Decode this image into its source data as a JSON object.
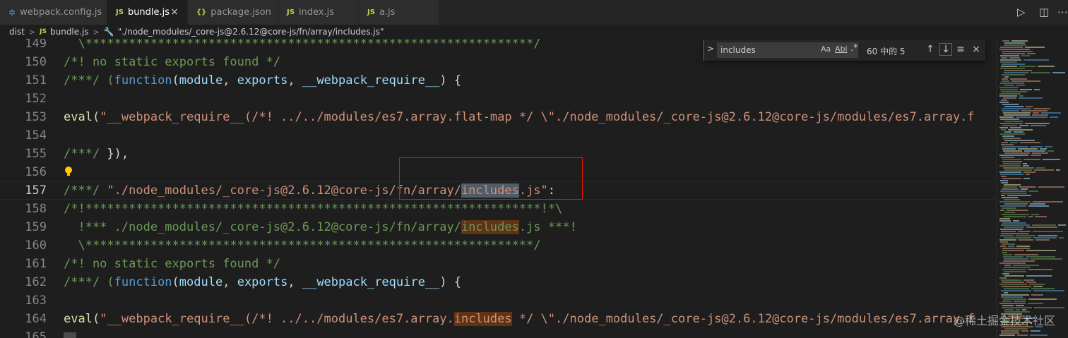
{
  "tabs": [
    {
      "label": "webpack.config.js",
      "icon": "webpack-icon",
      "active": false
    },
    {
      "label": "bundle.js",
      "icon": "js-file-icon",
      "active": true
    },
    {
      "label": "package.json",
      "icon": "json-file-icon",
      "active": false
    },
    {
      "label": "index.js",
      "icon": "js-file-icon",
      "active": false
    },
    {
      "label": "a.js",
      "icon": "js-file-icon",
      "active": false
    }
  ],
  "tab_icons": {
    "js": "JS",
    "json": "{}",
    "cfg": "✲",
    "close": "×",
    "run": "▷",
    "split": "◫",
    "more": "⋯"
  },
  "breadcrumb": {
    "folder": "dist",
    "file": "bundle.js",
    "symbol": "\"./node_modules/_core-js@2.6.12@core-js/fn/array/includes.js\""
  },
  "find": {
    "query": "includes",
    "match_case": "Aa",
    "whole_word": "Abl",
    "regex": ".*",
    "result_count": "60 中的 5"
  },
  "editor": {
    "line_numbers": [
      "149",
      "150",
      "151",
      "152",
      "153",
      "154",
      "155",
      "156",
      "157",
      "158",
      "159",
      "160",
      "161",
      "162",
      "163",
      "164",
      "165"
    ],
    "current_line": "157",
    "lines": {
      "l149": "  \\**************************************************************/",
      "l150": "/*! no static exports found */",
      "l151a": "/***/ (",
      "l151b": "function",
      "l151c": "(",
      "l151d": "module",
      "l151e": ", ",
      "l151f": "exports",
      "l151g": ", ",
      "l151h": "__webpack_require__",
      "l151i": ") {",
      "l153a": "eval",
      "l153b": "(",
      "l153c": "\"__webpack_require__(/*! ../../modules/es7.array.flat-map */ \\\"./node_modules/_core-js@2.6.12@core-js/modules/es7.array.f",
      "l155a": "/***/ ",
      "l155b": "}),",
      "l157a": "/***/ ",
      "l157b": "\"./node_modules/_core-js@2.6.12@core-js/fn/array/",
      "l157c": "includes",
      "l157d": ".js\"",
      "l157e": ":",
      "l158": "/*!***************************************************************!*\\",
      "l159a": "  !*** ./node_modules/_core-js@2.6.12@core-js/fn/array/",
      "l159b": "includes",
      "l159c": ".js ***!",
      "l160": "  \\**************************************************************/",
      "l161": "/*! no static exports found */",
      "l162a": "/***/ (",
      "l162b": "function",
      "l162c": "(",
      "l162d": "module",
      "l162e": ", ",
      "l162f": "exports",
      "l162g": ", ",
      "l162h": "__webpack_require__",
      "l162i": ") {",
      "l164a": "eval",
      "l164b": "(",
      "l164c": "\"__webpack_require__(/*! ../../modules/es7.array.",
      "l164d": "includes",
      "l164e": " */ \\\"./node_modules/_core-js@2.6.12@core-js/modules/es7.array.f"
    }
  },
  "watermark": "@稀土掘金技术社区",
  "colors": {
    "highlight_box": "#e51400",
    "current_match": "#515c6a",
    "other_match": "#613214"
  }
}
